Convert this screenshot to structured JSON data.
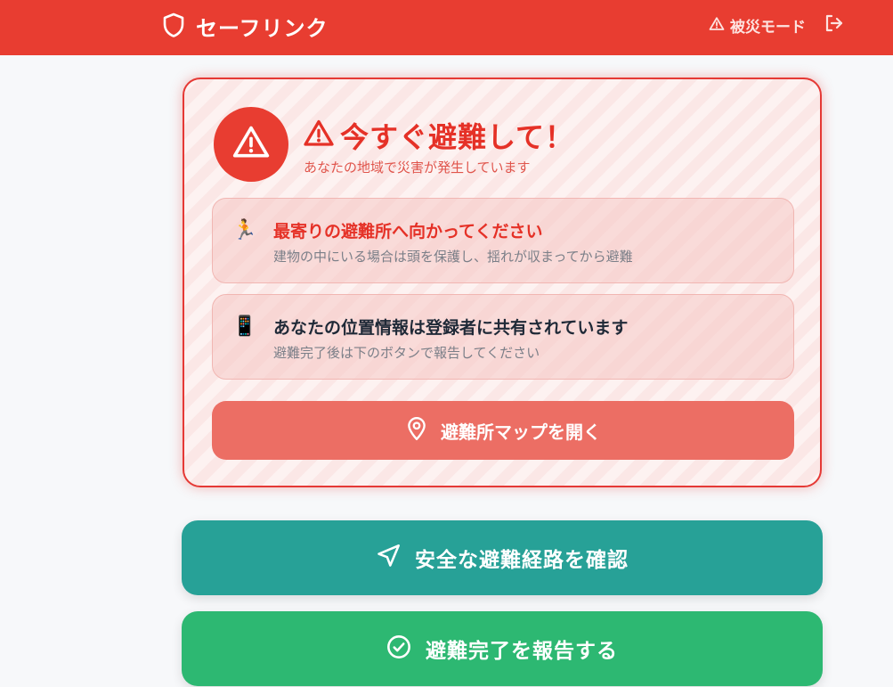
{
  "header": {
    "brand_icon": "shield-icon",
    "title": "セーフリンク",
    "mode_icon": "warning-triangle-icon",
    "mode_label": "被災モード",
    "logout_icon": "logout-icon",
    "background_color": "#e83d31"
  },
  "alert": {
    "icon": "warning-triangle-icon",
    "title": "今すぐ避難して！",
    "subtitle": "あなたの地域で災害が発生しています",
    "accent_color": "#e53935",
    "items": [
      {
        "icon": "running-person-icon",
        "emoji": "🏃",
        "title": "最寄りの避難所へ向かってください",
        "description": "建物の中にいる場合は頭を保護し、揺れが収まってから避難"
      },
      {
        "icon": "mobile-phone-icon",
        "emoji": "📱",
        "title": "あなたの位置情報は登録者に共有されています",
        "description": "避難完了後は下のボタンで報告してください"
      }
    ],
    "map_button": {
      "icon": "map-pin-icon",
      "label": "避難所マップを開く"
    }
  },
  "actions": {
    "route_button": {
      "icon": "navigation-arrow-icon",
      "label": "安全な避難経路を確認",
      "color": "#27a197"
    },
    "report_button": {
      "icon": "check-circle-icon",
      "label": "避難完了を報告する",
      "color": "#2db872"
    }
  }
}
